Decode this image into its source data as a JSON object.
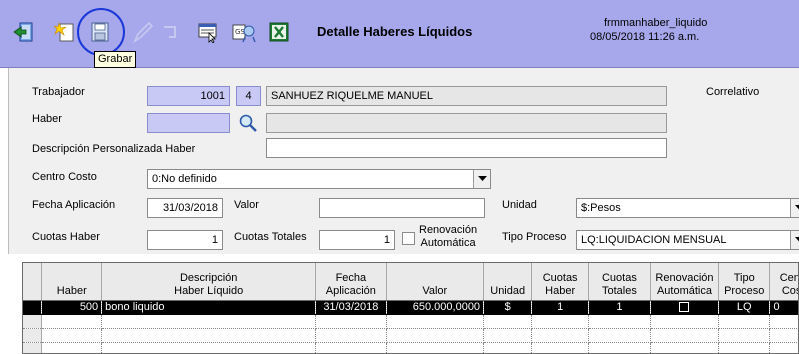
{
  "toolbar": {
    "tooltip": "Grabar",
    "title": "Detalle Haberes Líquidos",
    "form_name": "frmmanhaber_liquido",
    "datetime": "08/05/2018 11:26 a.m."
  },
  "form": {
    "trabajador_label": "Trabajador",
    "trabajador_code": "1001",
    "trabajador_digit": "4",
    "trabajador_name": "SANHUEZ RIQUELME MANUEL",
    "correlativo_label": "Correlativo",
    "haber_label": "Haber",
    "haber_code": "",
    "haber_desc": "",
    "descripcion_label": "Descripción Personalizada Haber",
    "descripcion_value": "",
    "centro_costo_label": "Centro Costo",
    "centro_costo_value": "0:No definido",
    "fecha_aplicacion_label": "Fecha Aplicación",
    "fecha_aplicacion_value": "31/03/2018",
    "valor_label": "Valor",
    "valor_value": "",
    "unidad_label": "Unidad",
    "unidad_value": "$:Pesos",
    "cuotas_haber_label": "Cuotas Haber",
    "cuotas_haber_value": "1",
    "cuotas_totales_label": "Cuotas Totales",
    "cuotas_totales_value": "1",
    "renovacion_label_1": "Renovación",
    "renovacion_label_2": "Automática",
    "tipo_proceso_label": "Tipo Proceso",
    "tipo_proceso_value": "LQ:LIQUIDACION MENSUAL"
  },
  "grid": {
    "headers": [
      [
        "",
        "Haber"
      ],
      [
        "Descripción",
        "Haber Líquido"
      ],
      [
        "Fecha",
        "Aplicación"
      ],
      [
        "",
        "Valor"
      ],
      [
        "",
        "Unidad"
      ],
      [
        "Cuotas",
        "Haber"
      ],
      [
        "Cuotas",
        "Totales"
      ],
      [
        "Renovación",
        "Automática"
      ],
      [
        "Tipo",
        "Proceso"
      ],
      [
        "Centro",
        "Costo"
      ]
    ],
    "rows": [
      [
        "500",
        "bono liquido",
        "31/03/2018",
        "650.000,0000",
        "$",
        "1",
        "1",
        "",
        "LQ",
        "0"
      ]
    ]
  }
}
